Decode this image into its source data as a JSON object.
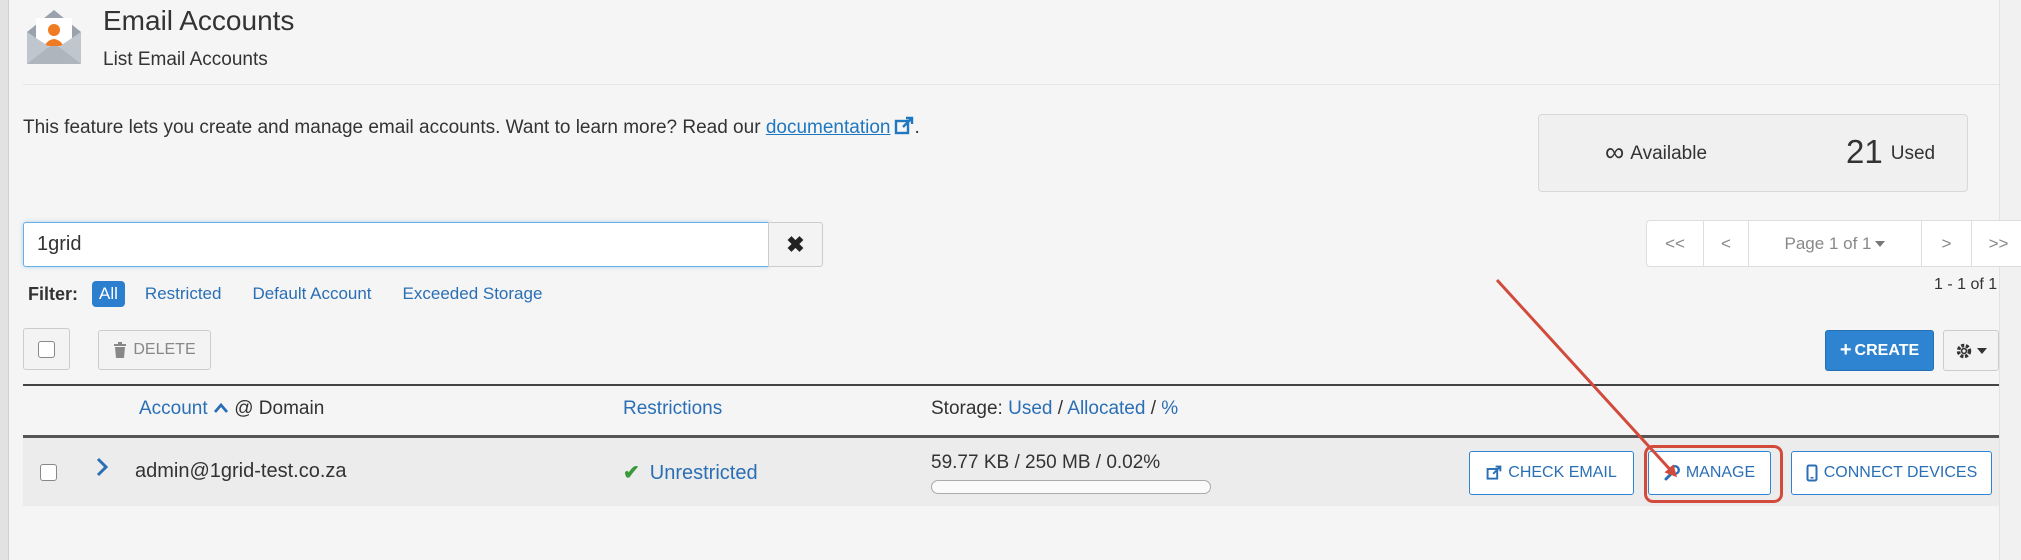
{
  "header": {
    "title": "Email Accounts",
    "subtitle": "List Email Accounts"
  },
  "intro": {
    "text": "This feature lets you create and manage email accounts. Want to learn more? Read our ",
    "link": "documentation",
    "suffix": "."
  },
  "stats": {
    "available_symbol": "∞",
    "available_label": "Available",
    "used_count": "21",
    "used_label": "Used"
  },
  "search": {
    "value": "1grid",
    "clear_symbol": "✖"
  },
  "filter": {
    "label": "Filter:",
    "options": [
      "All",
      "Restricted",
      "Default Account",
      "Exceeded Storage"
    ],
    "selected": "All"
  },
  "pager": {
    "first": "<<",
    "prev": "<",
    "page_label": "Page 1 of 1",
    "next": ">",
    "last": ">>",
    "range": "1 - 1 of 1"
  },
  "toolbar": {
    "delete_label": "DELETE",
    "create_label": "CREATE"
  },
  "table": {
    "headers": {
      "account": "Account",
      "at_domain": "@ Domain",
      "restrictions": "Restrictions",
      "storage_prefix": "Storage:",
      "used": "Used",
      "allocated": "Allocated",
      "percent": "%"
    },
    "rows": [
      {
        "account": "admin@1grid-test.co.za",
        "restriction": "Unrestricted",
        "storage": "59.77 KB / 250 MB / 0.02%",
        "usage_percent": 0.02,
        "actions": [
          "CHECK EMAIL",
          "MANAGE",
          "CONNECT DEVICES"
        ]
      }
    ]
  },
  "colors": {
    "accent": "#2e84d0",
    "link": "#2a6fb5",
    "highlight": "#d14a3c",
    "success": "#3a9a3a"
  }
}
